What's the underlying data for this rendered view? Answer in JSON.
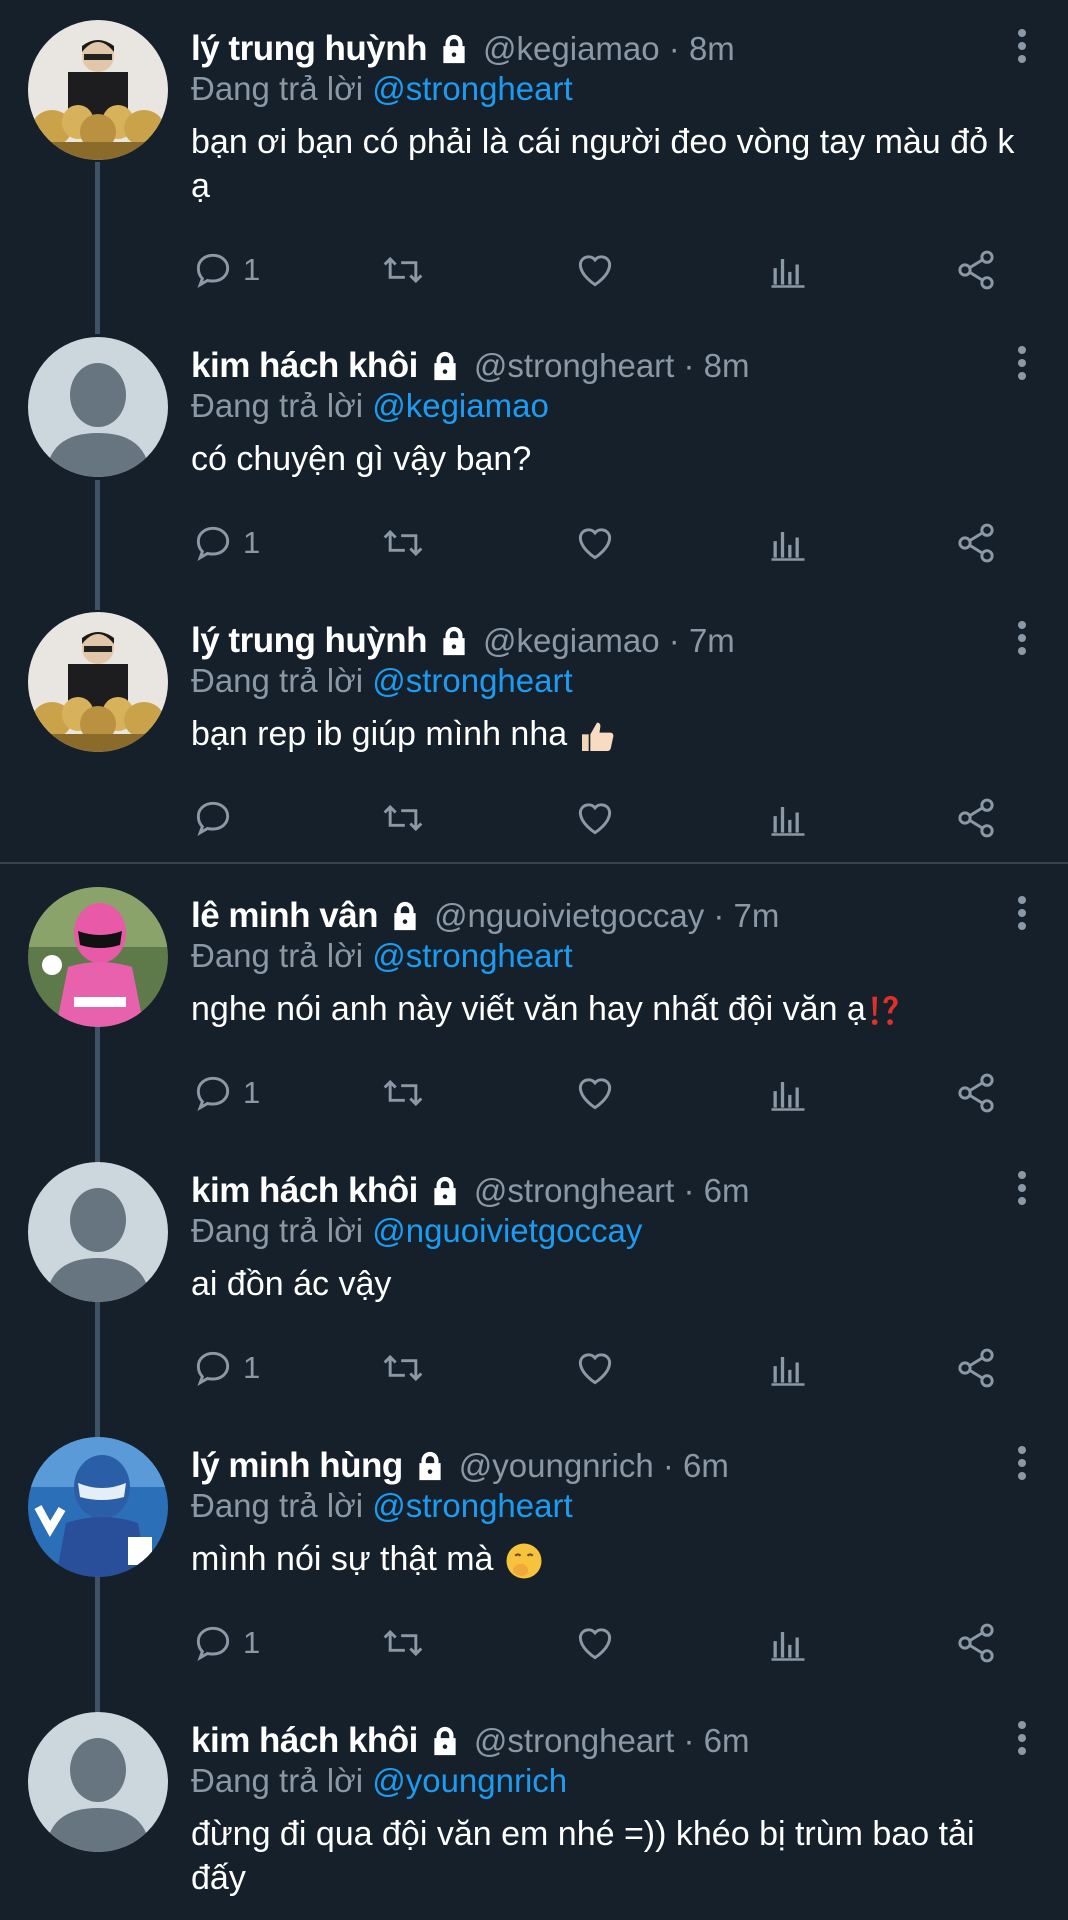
{
  "reply_prefix": "Đang trả lời",
  "tweets": [
    {
      "name": "lý trung huỳnh",
      "handle": "@kegiamao · 8m",
      "reply_to": "@strongheart",
      "text": "bạn ơi bạn có phải là cái người đeo vòng tay màu đỏ k ạ",
      "reply_count": "1",
      "avatar": "trophy-player"
    },
    {
      "name": "kim hách khôi",
      "handle": "@strongheart · 8m",
      "reply_to": "@kegiamao",
      "text": "có chuyện gì vậy bạn?",
      "reply_count": "1",
      "avatar": "default"
    },
    {
      "name": "lý trung huỳnh",
      "handle": "@kegiamao · 7m",
      "reply_to": "@strongheart",
      "text": "bạn rep ib giúp mình nha",
      "reply_count": "",
      "avatar": "trophy-player"
    },
    {
      "name": "lê minh vân",
      "handle": "@nguoivietgoccay · 7m",
      "reply_to": "@strongheart",
      "text": "nghe nói anh này viết văn hay nhất đội văn ạ",
      "reply_count": "1",
      "avatar": "pink-ranger"
    },
    {
      "name": "kim hách khôi",
      "handle": "@strongheart · 6m",
      "reply_to": "@nguoivietgoccay",
      "text": "ai đồn ác vậy",
      "reply_count": "1",
      "avatar": "default"
    },
    {
      "name": "lý minh hùng",
      "handle": "@youngnrich · 6m",
      "reply_to": "@strongheart",
      "text": "mình nói sự thật mà",
      "reply_count": "1",
      "avatar": "blue-ranger"
    },
    {
      "name": "kim hách khôi",
      "handle": "@strongheart · 6m",
      "reply_to": "@youngnrich",
      "text": "đừng đi qua đội văn em nhé =)) khéo bị trùm bao tải đấy",
      "reply_count": "",
      "avatar": "default"
    }
  ],
  "colors": {
    "background": "#15202b",
    "secondary": "#8b98a5",
    "mention": "#1d9bf0"
  }
}
